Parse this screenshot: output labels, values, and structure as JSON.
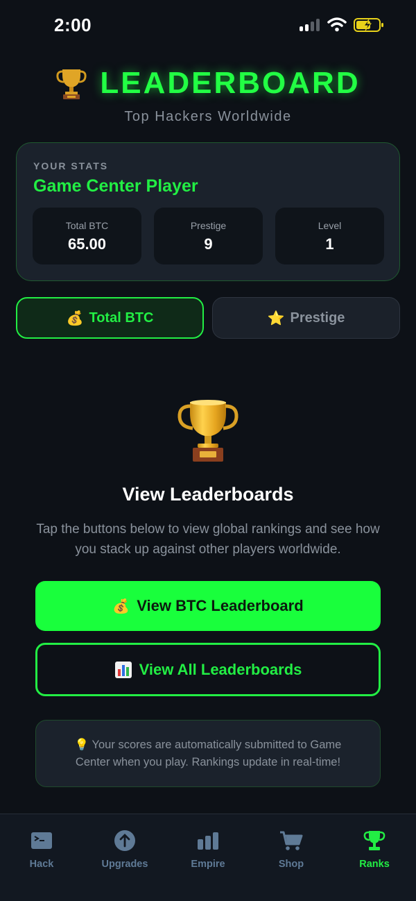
{
  "status_bar": {
    "time": "2:00"
  },
  "header": {
    "title": "LEADERBOARD",
    "subtitle": "Top Hackers Worldwide"
  },
  "stats": {
    "label": "YOUR STATS",
    "player_name": "Game Center Player",
    "items": [
      {
        "label": "Total BTC",
        "value": "65.00"
      },
      {
        "label": "Prestige",
        "value": "9"
      },
      {
        "label": "Level",
        "value": "1"
      }
    ]
  },
  "tabs": [
    {
      "label": "Total BTC",
      "icon": "money-bag-icon",
      "selected": true
    },
    {
      "label": "Prestige",
      "icon": "star-icon",
      "selected": false
    }
  ],
  "main": {
    "title": "View Leaderboards",
    "description": "Tap the buttons below to view global rankings and see how you stack up against other players worldwide.",
    "primary_button": "View BTC Leaderboard",
    "secondary_button": "View All Leaderboards",
    "info_text": "Your scores are automatically submitted to Game Center when you play. Rankings update in real-time!"
  },
  "tabbar": [
    {
      "label": "Hack",
      "icon": "terminal-icon"
    },
    {
      "label": "Upgrades",
      "icon": "arrow-up-circle-icon"
    },
    {
      "label": "Empire",
      "icon": "bar-chart-icon"
    },
    {
      "label": "Shop",
      "icon": "cart-icon"
    },
    {
      "label": "Ranks",
      "icon": "trophy-icon",
      "active": true
    }
  ],
  "colors": {
    "background": "#0d1117",
    "accent": "#22ee44",
    "card": "#1b222c",
    "muted": "#8a929c",
    "tab_inactive": "#5f7a96"
  }
}
